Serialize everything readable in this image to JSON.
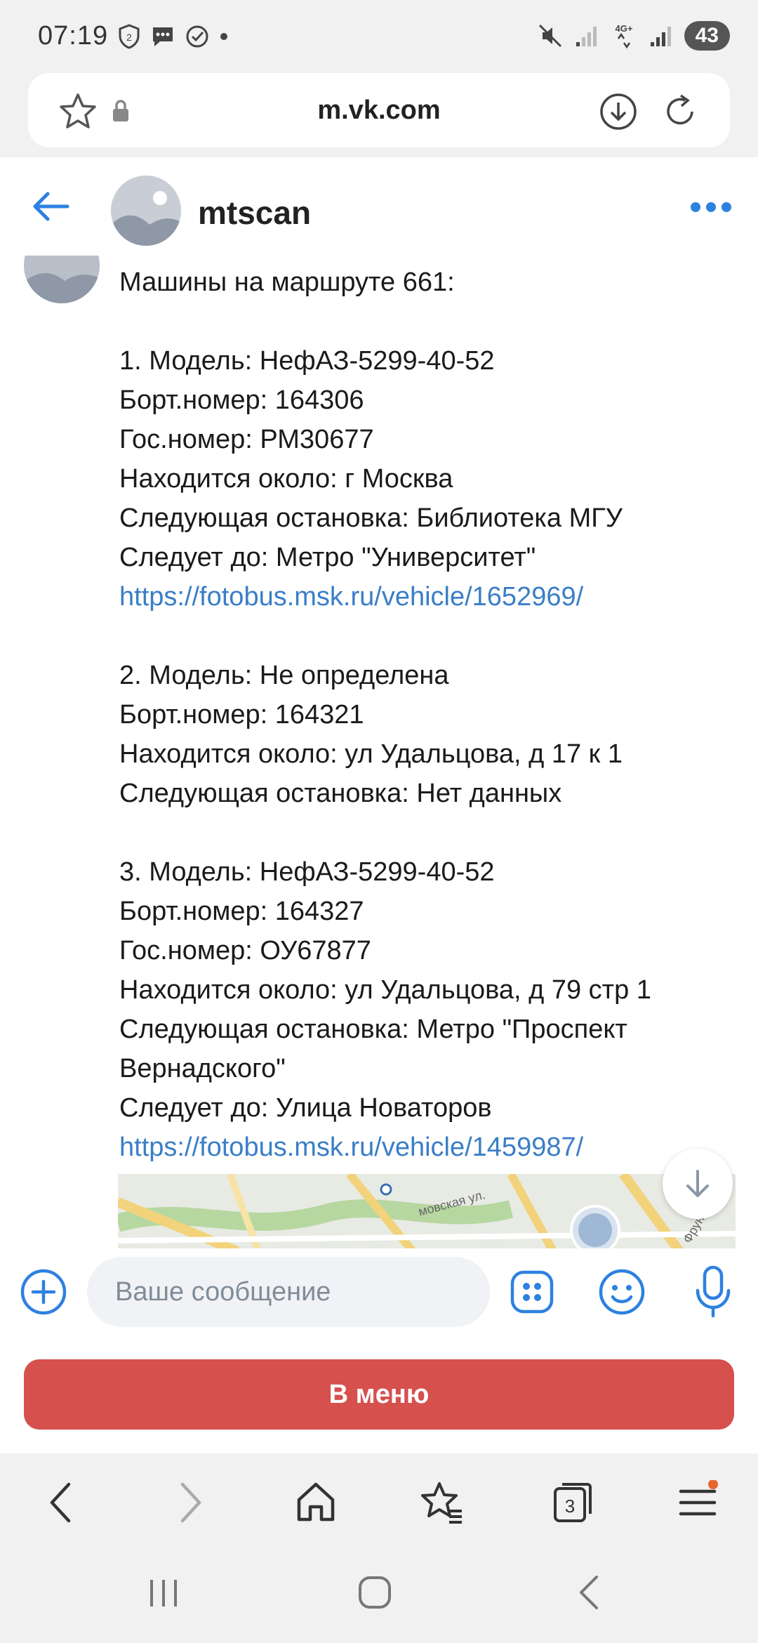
{
  "status_bar": {
    "time": "07:19",
    "network": "4G+",
    "battery": "43"
  },
  "browser": {
    "url": "m.vk.com"
  },
  "chat": {
    "title": "mtscan"
  },
  "message": {
    "lines": [
      {
        "text": "Машины на маршруте 661:"
      },
      {
        "gap": true
      },
      {
        "text": "1. Модель: НефАЗ-5299-40-52"
      },
      {
        "text": "Борт.номер: 164306"
      },
      {
        "text": "Гос.номер: РМ30677"
      },
      {
        "text": "Находится около: г Москва"
      },
      {
        "text": "Следующая остановка: Библиотека МГУ"
      },
      {
        "text": "Следует до: Метро \"Университет\""
      },
      {
        "text": "https://fotobus.msk.ru/vehicle/1652969/",
        "link": true
      },
      {
        "gap": true
      },
      {
        "text": "2. Модель: Не определена"
      },
      {
        "text": "Борт.номер: 164321"
      },
      {
        "text": "Находится около: ул Удальцова, д 17 к 1"
      },
      {
        "text": "Следующая остановка: Нет данных"
      },
      {
        "gap": true
      },
      {
        "text": "3. Модель: НефАЗ-5299-40-52"
      },
      {
        "text": "Борт.номер: 164327"
      },
      {
        "text": "Гос.номер: ОУ67877"
      },
      {
        "text": "Находится около: ул Удальцова, д 79 стр 1"
      },
      {
        "text": "Следующая остановка: Метро \"Проспект"
      },
      {
        "text": "Вернадского\""
      },
      {
        "text": "Следует до: Улица Новаторов"
      },
      {
        "text": "https://fotobus.msk.ru/vehicle/1459987/",
        "link": true
      }
    ],
    "map_street_label": "мовская ул.",
    "map_street_label_2": "Фрунзе"
  },
  "composer": {
    "placeholder": "Ваше сообщение"
  },
  "keyboard": {
    "menu_button": "В меню"
  },
  "browser_toolbar": {
    "tabs_count": "3"
  },
  "colors": {
    "accent": "#2d81e0",
    "link": "#3a7ec7",
    "menu_button": "#d6504e",
    "chrome_bg": "#f1f1f1"
  }
}
